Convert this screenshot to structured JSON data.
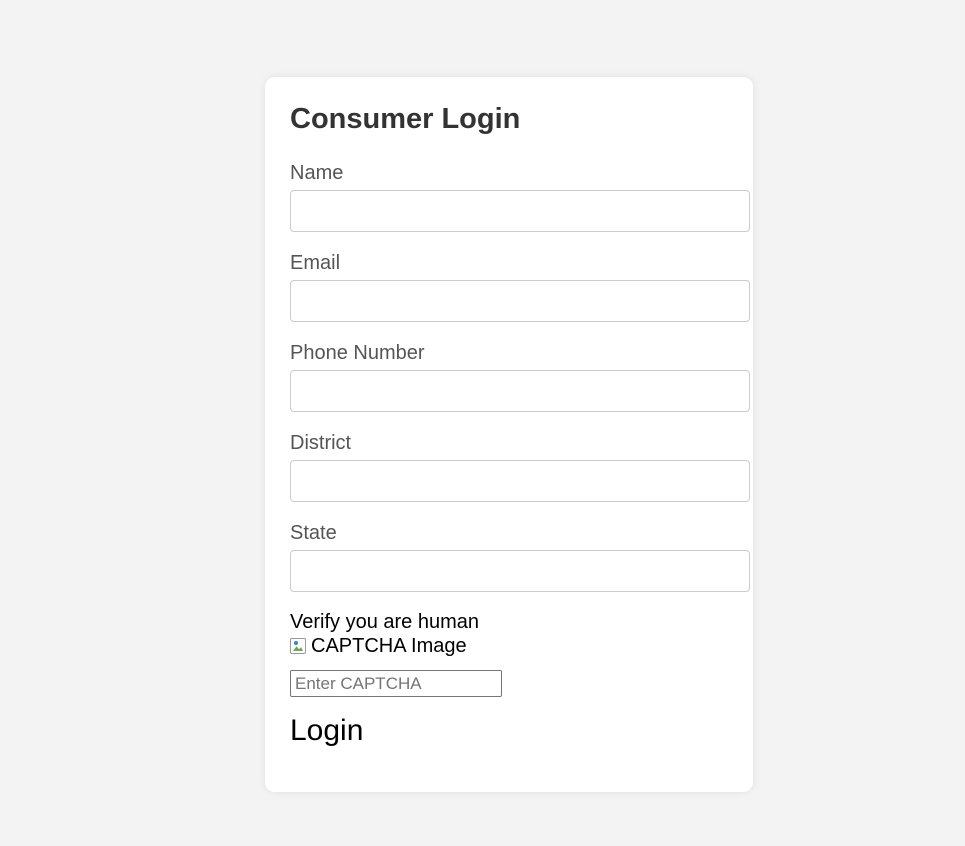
{
  "form": {
    "title": "Consumer Login",
    "fields": [
      {
        "label": "Name",
        "value": "",
        "placeholder": ""
      },
      {
        "label": "Email",
        "value": "",
        "placeholder": ""
      },
      {
        "label": "Phone Number",
        "value": "",
        "placeholder": ""
      },
      {
        "label": "District",
        "value": "",
        "placeholder": ""
      },
      {
        "label": "State",
        "value": "",
        "placeholder": ""
      }
    ],
    "captcha": {
      "prompt": "Verify you are human",
      "image_alt": "CAPTCHA Image",
      "input_value": "",
      "input_placeholder": "Enter CAPTCHA",
      "image_icon": "broken-image-icon"
    },
    "submit_label": "Login"
  },
  "colors": {
    "page_background": "#f3f3f3",
    "card_background": "#ffffff",
    "title_text": "#333333",
    "label_text": "#555555",
    "input_border": "#cccccc"
  }
}
